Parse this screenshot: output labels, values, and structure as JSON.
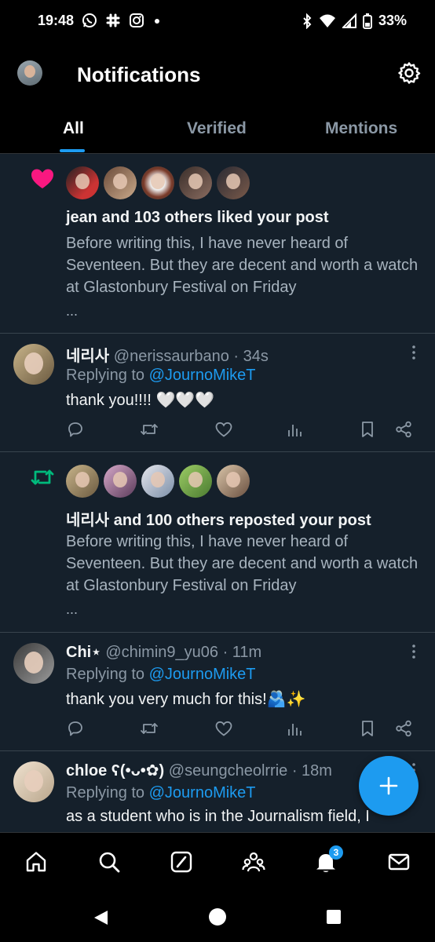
{
  "status_bar": {
    "time": "19:48",
    "left_icons": [
      "whatsapp-icon",
      "slack-icon",
      "instagram-icon",
      "dot-icon"
    ],
    "right_icons": [
      "bluetooth-icon",
      "wifi-icon",
      "signal-icon",
      "battery-icon"
    ],
    "battery": "33%"
  },
  "header": {
    "title": "Notifications",
    "tabs": [
      {
        "label": "All",
        "active": true
      },
      {
        "label": "Verified",
        "active": false
      },
      {
        "label": "Mentions",
        "active": false
      }
    ]
  },
  "notifications": [
    {
      "type": "like",
      "icon": "heart-icon",
      "icon_color": "#f91880",
      "title": "jean and 103 others liked your post",
      "body": "Before writing this, I have never heard of Seventeen. But they are decent and worth a watch at Glastonbury Festival on Friday",
      "ellipsis": "..."
    },
    {
      "type": "reply",
      "name": "네리사",
      "handle": "@nerissaurbano · 34s",
      "replying_prefix": "Replying to ",
      "replying_to": "@JournoMikeT",
      "text": "thank you!!!! 🤍🤍🤍"
    },
    {
      "type": "repost",
      "icon": "repost-icon",
      "icon_color": "#00ba7c",
      "title": "네리사 and 100 others reposted your post",
      "body": "Before writing this, I have never heard of Seventeen. But they are decent and worth a watch at Glastonbury Festival on Friday",
      "ellipsis": "..."
    },
    {
      "type": "reply",
      "name": "Chi⋆",
      "handle": "@chimin9_yu06 · 11m",
      "replying_prefix": "Replying to ",
      "replying_to": "@JournoMikeT",
      "text": "thank you very much for this!🫂✨"
    },
    {
      "type": "reply",
      "name": "chloe ʕ(•ᴗ•✿)",
      "handle": "@seungcheolrrie · 18m",
      "replying_prefix": "Replying to ",
      "replying_to": "@JournoMikeT",
      "text": "as a student who is in the Journalism field, I"
    }
  ],
  "fab_icon": "plus-icon",
  "bottom_nav": {
    "items": [
      "home-icon",
      "search-icon",
      "grok-icon",
      "communities-icon",
      "notifications-bell-icon",
      "messages-icon"
    ],
    "notification_badge": "3"
  },
  "system_nav": [
    "back-icon",
    "home-circle-icon",
    "recents-icon"
  ],
  "colors": {
    "accent": "#1d9bf0",
    "like": "#f91880",
    "repost": "#00ba7c",
    "feed_bg": "#15202b"
  }
}
